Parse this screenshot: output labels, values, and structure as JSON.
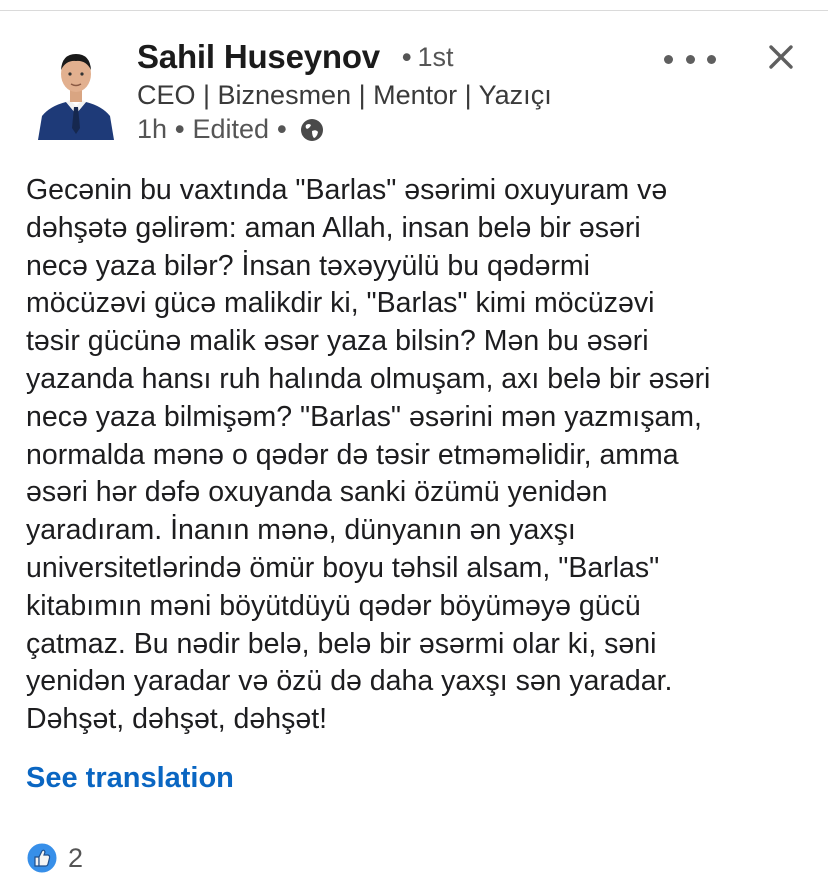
{
  "post": {
    "author": {
      "name": "Sahil Huseynov",
      "connection_degree": "1st",
      "headline": "CEO | Biznesmen | Mentor | Yazıçı",
      "avatar_icon": "profile-photo"
    },
    "meta": {
      "time": "1h",
      "edited": "Edited",
      "visibility_icon": "globe-icon"
    },
    "actions": {
      "more_icon": "more-horizontal-icon",
      "close_icon": "close-icon"
    },
    "body_lines": [
      "Gecənin bu vaxtında \"Barlas\" əsərimi oxuyuram və",
      "dəhşətə gəlirəm: aman Allah, insan belə bir əsəri",
      "necə yaza bilər? İnsan təxəyyülü bu qədərmi",
      "möcüzəvi gücə malikdir ki, \"Barlas\" kimi möcüzəvi",
      "təsir gücünə malik əsər yaza bilsin? Mən bu əsəri",
      "yazanda hansı ruh halında olmuşam, axı belə bir əsəri",
      "necə yaza bilmişəm? \"Barlas\" əsərini mən yazmışam,",
      "normalda mənə o qədər də təsir etməməlidir, amma",
      "əsəri hər dəfə oxuyanda sanki özümü yenidən",
      "yaradıram. İnanın mənə, dünyanın ən yaxşı",
      "universitetlərində ömür boyu təhsil alsam, \"Barlas\"",
      "kitabımın məni böyütdüyü qədər böyüməyə gücü",
      "çatmaz. Bu nədir belə, belə bir əsərmi olar ki, səni",
      "yenidən yaradar və özü də daha yaxşı sən yaradar.",
      "Dəhşət, dəhşət, dəhşət!"
    ],
    "see_translation": "See translation",
    "reactions": {
      "icon": "like-icon",
      "count": "2"
    }
  },
  "colors": {
    "link_blue": "#0a66c2",
    "like_blue": "#378fe9",
    "text_primary": "#1d1d1f",
    "text_secondary": "#555555"
  }
}
